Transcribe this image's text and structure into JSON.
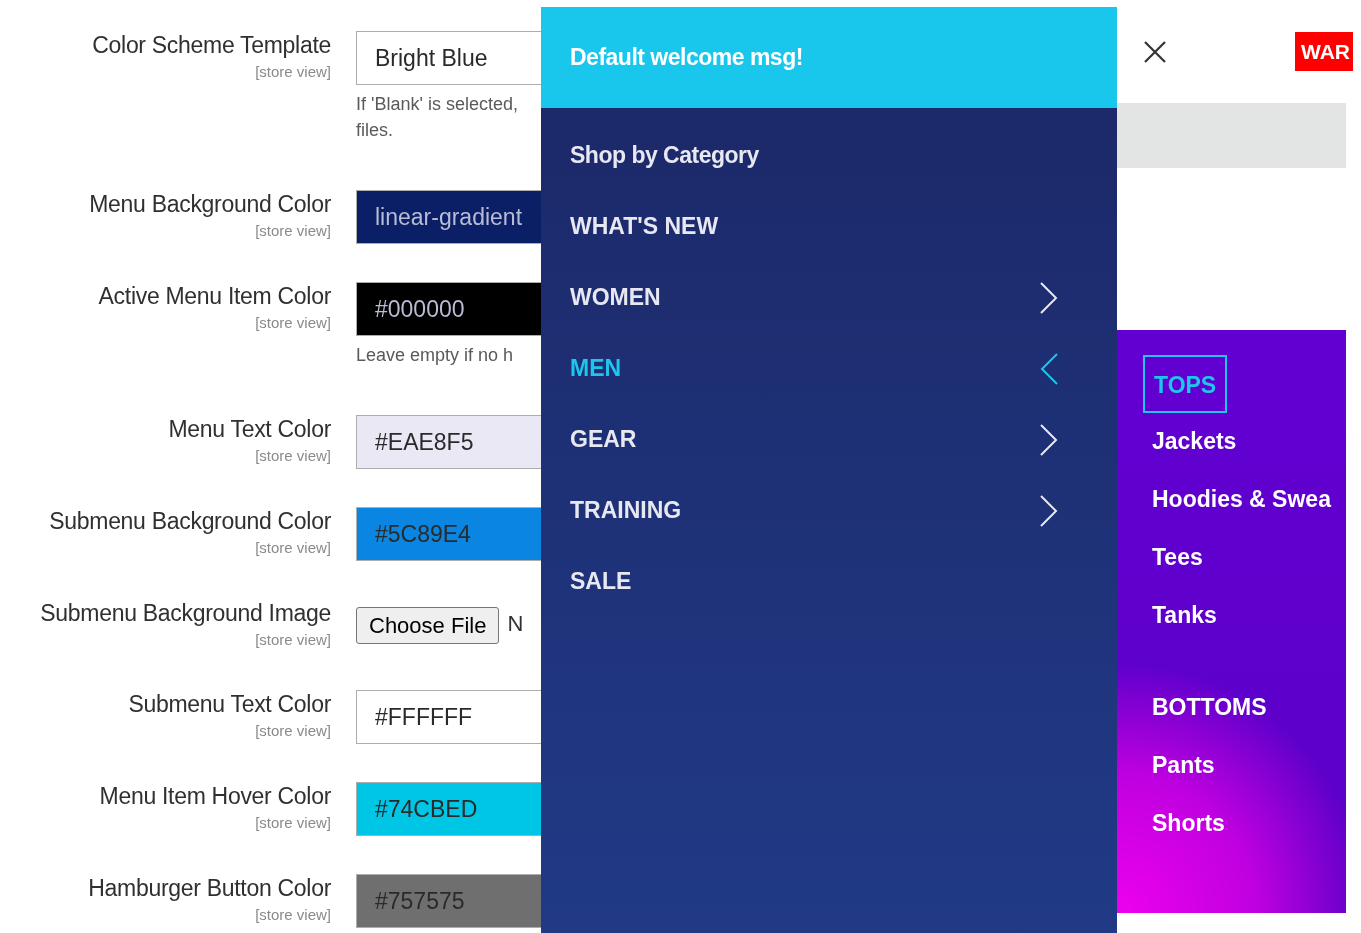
{
  "settings": [
    {
      "label": "Color Scheme Template",
      "scope": "[store view]",
      "kind": "select",
      "value": "Bright Blue",
      "color": "#ffffff",
      "hint": "If 'Blank' is selected, files."
    },
    {
      "label": "Menu Background Color",
      "scope": "[store view]",
      "kind": "color",
      "value": "linear-gradient",
      "color": "#0b1f66"
    },
    {
      "label": "Active Menu Item Color",
      "scope": "[store view]",
      "kind": "color",
      "value": "#000000",
      "color": "#000000",
      "hint": "Leave empty if no h"
    },
    {
      "label": "Menu Text Color",
      "scope": "[store view]",
      "kind": "color",
      "value": "#EAE8F5",
      "color": "#eae8f5"
    },
    {
      "label": "Submenu Background Color",
      "scope": "[store view]",
      "kind": "color",
      "value": "#5C89E4",
      "color": "#0a86e2"
    },
    {
      "label": "Submenu Background Image",
      "scope": "[store view]",
      "kind": "file",
      "value": "Choose File",
      "status": "N"
    },
    {
      "label": "Submenu Text Color",
      "scope": "[store view]",
      "kind": "color",
      "value": "#FFFFFF",
      "color": "#ffffff"
    },
    {
      "label": "Menu Item Hover Color",
      "scope": "[store view]",
      "kind": "color",
      "value": "#74CBED",
      "color": "#00c6e6"
    },
    {
      "label": "Hamburger Button Color",
      "scope": "[store view]",
      "kind": "color",
      "value": "#757575",
      "color": "#6f6f6f"
    }
  ],
  "menu": {
    "welcome": "Default welcome msg!",
    "items": [
      {
        "label": "Shop by Category",
        "kind": "title",
        "selected": false,
        "has_children": false
      },
      {
        "label": "WHAT'S NEW",
        "kind": "link",
        "selected": false,
        "has_children": false
      },
      {
        "label": "WOMEN",
        "kind": "link",
        "selected": false,
        "has_children": true
      },
      {
        "label": "MEN",
        "kind": "link",
        "selected": true,
        "has_children": true
      },
      {
        "label": "GEAR",
        "kind": "link",
        "selected": false,
        "has_children": true
      },
      {
        "label": "TRAINING",
        "kind": "link",
        "selected": false,
        "has_children": true
      },
      {
        "label": "SALE",
        "kind": "link",
        "selected": false,
        "has_children": false
      }
    ]
  },
  "header": {
    "badge": "WAR"
  },
  "submenu": {
    "items": [
      {
        "label": "TOPS",
        "kind": "heading",
        "selected": true
      },
      {
        "label": "Jackets",
        "kind": "link",
        "selected": false
      },
      {
        "label": "Hoodies & Swea",
        "kind": "link",
        "selected": false
      },
      {
        "label": "Tees",
        "kind": "link",
        "selected": false
      },
      {
        "label": "Tanks",
        "kind": "link",
        "selected": false
      },
      {
        "label": "BOTTOMS",
        "kind": "heading",
        "selected": false
      },
      {
        "label": "Pants",
        "kind": "link",
        "selected": false
      },
      {
        "label": "Shorts",
        "kind": "link",
        "selected": false
      }
    ]
  }
}
